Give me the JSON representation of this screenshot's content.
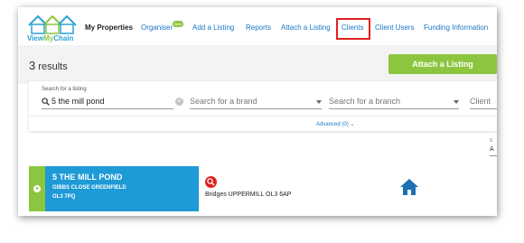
{
  "nav": {
    "logo": {
      "part1": "View",
      "part2": "My",
      "part3": "Chain"
    },
    "items": [
      {
        "label": "My Properties"
      },
      {
        "label": "Organiser",
        "badge": "New"
      },
      {
        "label": "Add a Listing"
      },
      {
        "label": "Reports"
      },
      {
        "label": "Attach a Listing"
      },
      {
        "label": "Clients"
      },
      {
        "label": "Client Users"
      },
      {
        "label": "Funding Information"
      }
    ],
    "highlighted": "Clients"
  },
  "results": {
    "count": "3",
    "label": "results"
  },
  "actions": {
    "attach_listing": "Attach a Listing"
  },
  "search": {
    "listing_label": "Search for a listing",
    "listing_value": "5 the mill pond",
    "brand_placeholder": "Search for a brand",
    "branch_placeholder": "Search for a branch",
    "client_placeholder": "Client",
    "advanced": "Advanced (0)"
  },
  "sort": {
    "label": "S",
    "value": "A"
  },
  "listing": {
    "title": "5 THE MILL POND",
    "address_line1": "GIBBS CLOSE GREENFIELD",
    "address_line2": "OL3 7PQ",
    "agent": "Bridges UPPERMILL OL3 6AP"
  },
  "colors": {
    "brand_blue": "#1e9ad6",
    "brand_green": "#8cc63f",
    "link_blue": "#1976c4",
    "highlight_red": "#e02020"
  },
  "icons": [
    "logo-houses-icon",
    "search-icon",
    "clear-icon",
    "chevron-down-icon",
    "agent-search-icon",
    "home-icon"
  ]
}
